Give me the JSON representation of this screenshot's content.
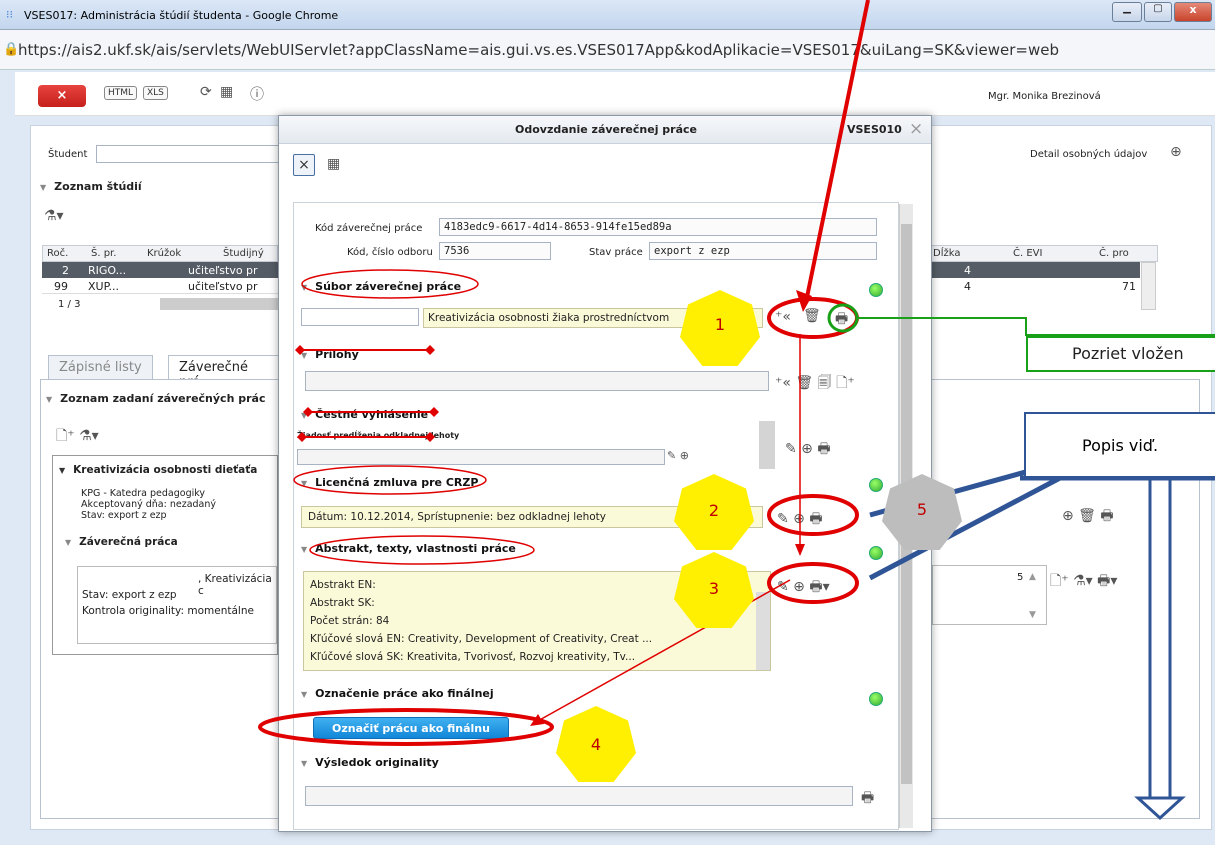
{
  "window": {
    "title": "VSES017: Administrácia štúdií študenta - Google Chrome"
  },
  "browser": {
    "url": "https://ais2.ukf.sk/ais/servlets/WebUIServlet?appClassName=ais.gui.vs.es.VSES017App&kodAplikacie=VSES017&uiLang=SK&viewer=web"
  },
  "toolbar": {
    "close_label": "×",
    "html_label": "HTML",
    "xls_label": "XLS",
    "user": "Mgr. Monika Brezinová"
  },
  "student": {
    "label": "Študent",
    "detail_label": "Detail osobných údajov"
  },
  "studies": {
    "title": "Zoznam štúdií",
    "headers": [
      "Roč.",
      "Š. pr.",
      "Krúžok",
      "Študijný",
      "Dĺžka",
      "Č. EVI",
      "Č. pro"
    ],
    "rows": [
      {
        "roc": "2",
        "spr": "RIGO...",
        "studijny": "učiteľstvo pr",
        "dlzka": "4",
        "evi": "",
        "pro": ""
      },
      {
        "roc": "99",
        "spr": "XUP...",
        "studijny": "učiteľstvo pr",
        "dlzka": "4",
        "evi": "",
        "pro": "71"
      }
    ],
    "pager": "1  /  3"
  },
  "tabs": [
    "Zápisné listy",
    "Záverečné prá"
  ],
  "assignments": {
    "title": "Zoznam zadaní záverečných prác",
    "item_title": "Kreativizácia osobnosti dieťaťa",
    "dept": "KPG - Katedra pedagogiky",
    "accepted": "Akceptovaný dňa: nezadaný",
    "status": "Stav: export z ezp",
    "sub_title": "Záverečná práca",
    "sub_name": ", Kreativizácia c",
    "sub_status": "Stav: export z ezp",
    "sub_orig": "Kontrola originality: momentálne",
    "count": "5"
  },
  "dialog": {
    "title": "Odovzdanie záverečnej práce",
    "code": "VSES010",
    "kod_label": "Kód záverečnej práce",
    "kod_value": "4183edc9-6617-4d14-8653-914fe15ed89a",
    "odbor_label": "Kód, číslo odboru",
    "odbor_value": "7536",
    "stav_label": "Stav práce",
    "stav_value": "export z ezp",
    "sec_subor": "Súbor záverečnej práce",
    "subor_value": "Kreativizácia osobnosti žiaka prostredníctvom",
    "sec_prilohy": "Prílohy",
    "sec_cestne": "Čestné vyhlásenie",
    "sec_ziadost": "Žiadosť predĺženia odkladnej lehoty",
    "sec_licencna": "Licenčná zmluva pre CRZP",
    "licencna_value": "Dátum: 10.12.2014, Sprístupnenie: bez odkladnej lehoty",
    "sec_abstrakt": "Abstrakt, texty, vlastnosti práce",
    "abstrakt_lines": [
      "Abstrakt EN:",
      "Abstrakt SK:",
      "Počet strán: 84",
      "Kľúčové slová EN: Creativity, Development of Creativity, Creat ...",
      "Kľúčové slová SK: Kreativita, Tvorivosť, Rozvoj kreativity, Tv..."
    ],
    "sec_final": "Označenie práce ako finálnej",
    "final_button": "Označiť prácu ako finálnu",
    "sec_vysledok": "Výsledok originality"
  },
  "annotations": {
    "n1": "1",
    "n2": "2",
    "n3": "3",
    "n4": "4",
    "n5": "5",
    "pozriet": "Pozriet vložen",
    "popis": "Popis viď."
  }
}
